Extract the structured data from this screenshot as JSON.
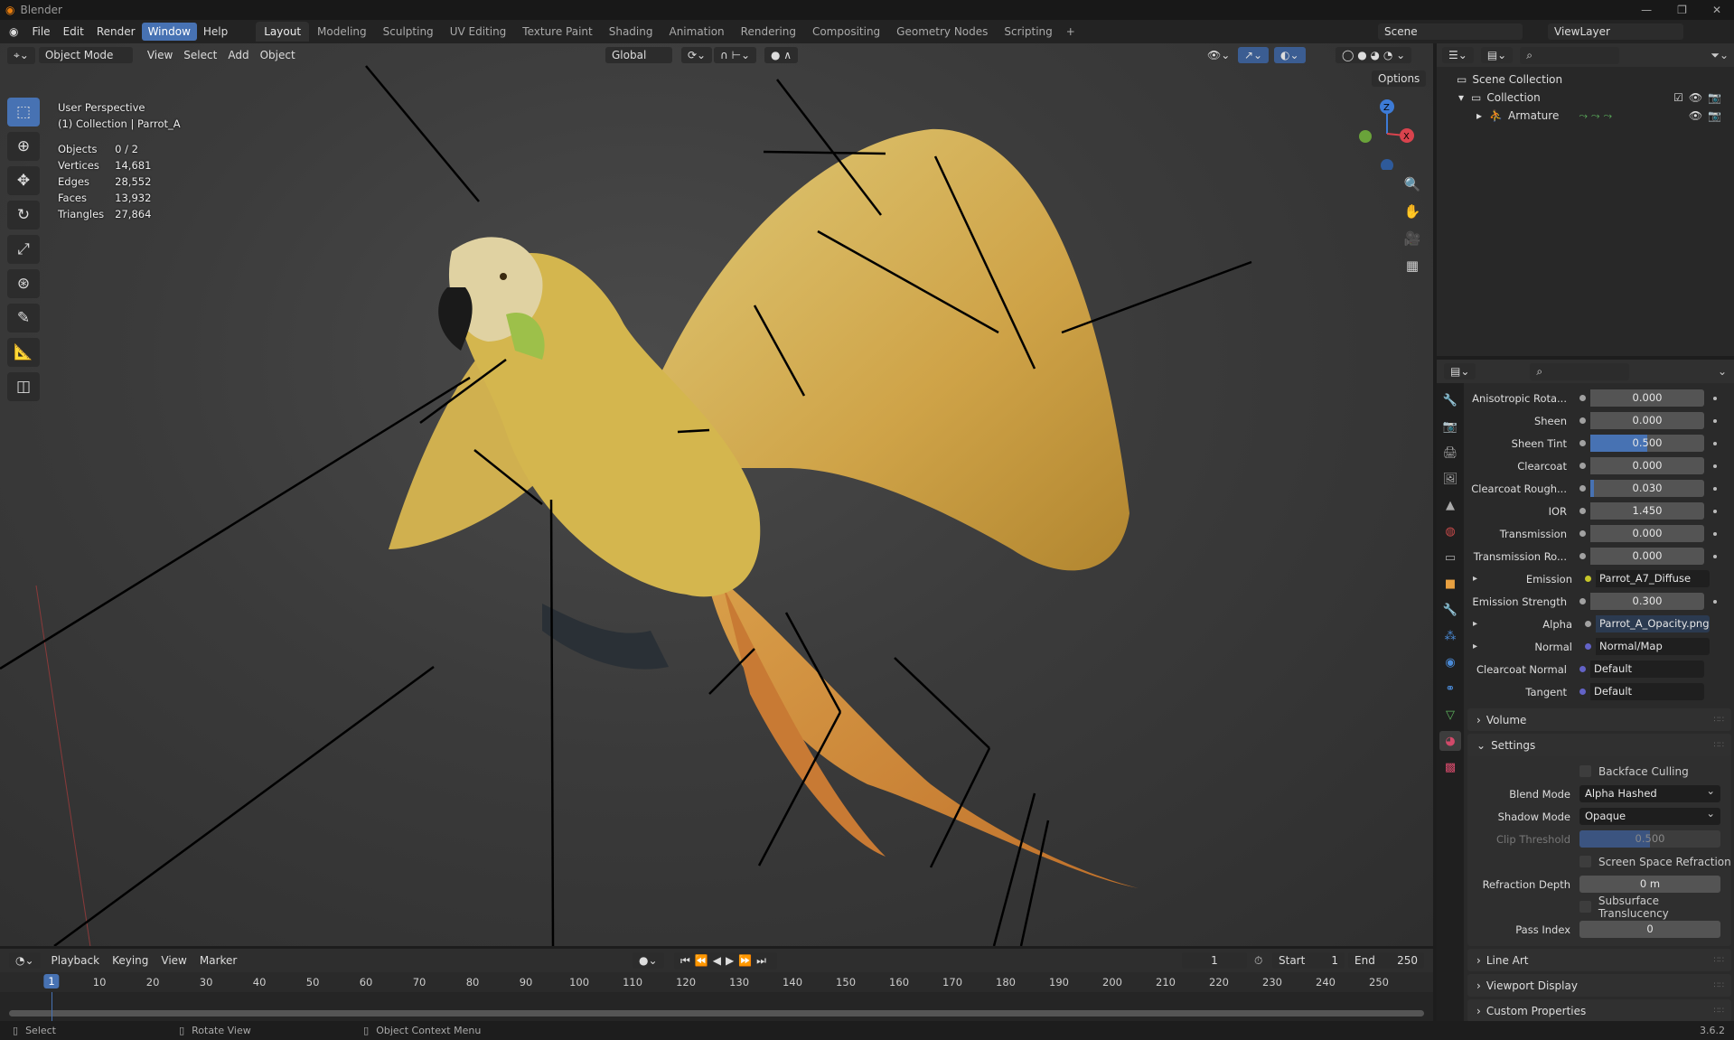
{
  "app": {
    "title": "Blender",
    "version": "3.6.2"
  },
  "menu": [
    "File",
    "Edit",
    "Render",
    "Window",
    "Help"
  ],
  "workspaces": [
    "Layout",
    "Modeling",
    "Sculpting",
    "UV Editing",
    "Texture Paint",
    "Shading",
    "Animation",
    "Rendering",
    "Compositing",
    "Geometry Nodes",
    "Scripting"
  ],
  "scene": {
    "name": "Scene",
    "view_layer": "ViewLayer"
  },
  "viewport": {
    "mode": "Object Mode",
    "menus": [
      "View",
      "Select",
      "Add",
      "Object"
    ],
    "orientation": "Global",
    "options": "Options",
    "perspective": "User Perspective",
    "collection_label": "(1) Collection | Parrot_A",
    "stats": [
      [
        "Objects",
        "0 / 2"
      ],
      [
        "Vertices",
        "14,681"
      ],
      [
        "Edges",
        "28,552"
      ],
      [
        "Faces",
        "13,932"
      ],
      [
        "Triangles",
        "27,864"
      ]
    ],
    "gizmo": {
      "z": "Z",
      "x": "X"
    }
  },
  "outliner": {
    "items": [
      {
        "label": "Scene Collection"
      },
      {
        "label": "Collection"
      },
      {
        "label": "Armature"
      }
    ]
  },
  "properties": {
    "rows": [
      {
        "label": "Anisotropic Rota...",
        "value": "0.000",
        "type": "num",
        "fill": 0
      },
      {
        "label": "Sheen",
        "value": "0.000",
        "type": "num",
        "fill": 0
      },
      {
        "label": "Sheen Tint",
        "value": "0.500",
        "type": "num",
        "fill": 0.5
      },
      {
        "label": "Clearcoat",
        "value": "0.000",
        "type": "num",
        "fill": 0
      },
      {
        "label": "Clearcoat Rough...",
        "value": "0.030",
        "type": "num",
        "fill": 0.03
      },
      {
        "label": "IOR",
        "value": "1.450",
        "type": "num",
        "fill": 0
      },
      {
        "label": "Transmission",
        "value": "0.000",
        "type": "num",
        "fill": 0
      },
      {
        "label": "Transmission Ro...",
        "value": "0.000",
        "type": "num",
        "fill": 0
      },
      {
        "label": "Emission",
        "value": "Parrot_A7_Diffuse",
        "type": "link",
        "socket": "#c7c729",
        "expand": true
      },
      {
        "label": "Emission Strength",
        "value": "0.300",
        "type": "num",
        "fill": 0
      },
      {
        "label": "Alpha",
        "value": "Parrot_A_Opacity.png",
        "type": "link",
        "socket": "#a1a1a1",
        "expand": true
      },
      {
        "label": "Normal",
        "value": "Normal/Map",
        "type": "link",
        "socket": "#6363c7",
        "expand": true
      },
      {
        "label": "Clearcoat Normal",
        "value": "Default",
        "type": "link",
        "socket": "#6363c7"
      },
      {
        "label": "Tangent",
        "value": "Default",
        "type": "link",
        "socket": "#6363c7"
      }
    ],
    "volume": "Volume",
    "settings": {
      "title": "Settings",
      "backface_culling": "Backface Culling",
      "blend_mode_label": "Blend Mode",
      "blend_mode": "Alpha Hashed",
      "shadow_mode_label": "Shadow Mode",
      "shadow_mode": "Opaque",
      "clip_label": "Clip Threshold",
      "clip": "0.500",
      "clip_fill": 0.5,
      "ssr": "Screen Space Refraction",
      "refraction_label": "Refraction Depth",
      "refraction": "0 m",
      "subsurface": "Subsurface Translucency",
      "pass_label": "Pass Index",
      "pass": "0"
    },
    "panels": [
      "Line Art",
      "Viewport Display",
      "Custom Properties"
    ]
  },
  "timeline": {
    "menus": [
      "Playback",
      "Keying",
      "View",
      "Marker"
    ],
    "current_frame": "1",
    "start_label": "Start",
    "start": "1",
    "end_label": "End",
    "end": "250",
    "ticks": [
      "1",
      "10",
      "20",
      "30",
      "40",
      "50",
      "60",
      "70",
      "80",
      "90",
      "100",
      "110",
      "120",
      "130",
      "140",
      "150",
      "160",
      "170",
      "180",
      "190",
      "200",
      "210",
      "220",
      "230",
      "240",
      "250"
    ]
  },
  "statusbar": {
    "select": "Select",
    "rotate": "Rotate View",
    "context": "Object Context Menu"
  }
}
